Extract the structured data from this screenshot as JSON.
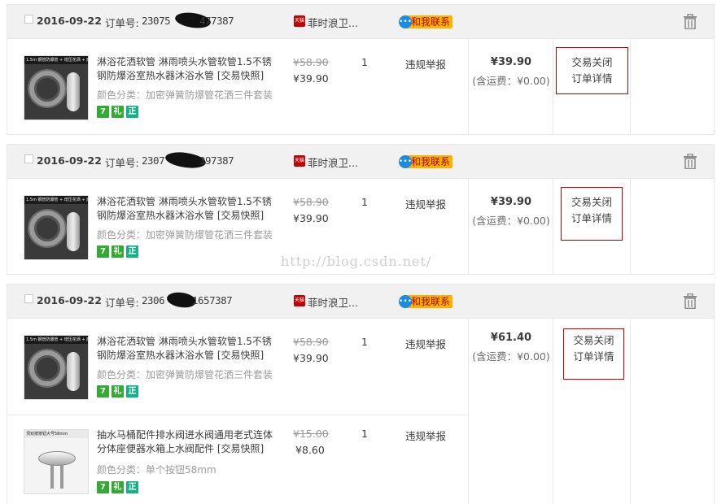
{
  "orders": [
    {
      "date": "2016-09-22",
      "order_label": "订单号:",
      "order_no_start": "23075",
      "order_no_end": "477387",
      "shop_badge": "天猫",
      "shop_name": "菲时浪卫...",
      "contact_label": "和我联系",
      "items": [
        {
          "title": "淋浴花洒软管 淋雨喷头水管软管1.5不锈钢防爆浴室热水器沐浴水管 [交易快照]",
          "sku": "颜色分类：加密弹簧防爆管花洒三件套装",
          "thumb_caption": "1.5m 钢管防爆管 + 增压花洒 + 底座",
          "orig_price": "¥58.90",
          "price": "¥39.90",
          "qty": "1",
          "action": "违规举报",
          "badges": [
            "7",
            "礼",
            "正"
          ]
        }
      ],
      "total": "¥39.90",
      "shipping": "(含运费：¥0.00)",
      "status": "交易关闭",
      "detail": "订单详情"
    },
    {
      "date": "2016-09-22",
      "order_label": "订单号:",
      "order_no_start": "2307",
      "order_no_end": "397387",
      "shop_badge": "天猫",
      "shop_name": "菲时浪卫...",
      "contact_label": "和我联系",
      "items": [
        {
          "title": "淋浴花洒软管 淋雨喷头水管软管1.5不锈钢防爆浴室热水器沐浴水管 [交易快照]",
          "sku": "颜色分类：加密弹簧防爆管花洒三件套装",
          "thumb_caption": "1.5m 钢管防爆管 + 增压花洒 + 底座",
          "orig_price": "¥58.90",
          "price": "¥39.90",
          "qty": "1",
          "action": "违规举报",
          "badges": [
            "7",
            "礼",
            "正"
          ]
        }
      ],
      "total": "¥39.90",
      "shipping": "(含运费：¥0.00)",
      "status": "交易关闭",
      "detail": "订单详情"
    },
    {
      "date": "2016-09-22",
      "order_label": "订单号:",
      "order_no_start": "2306",
      "order_no_end": "1657387",
      "shop_badge": "天猫",
      "shop_name": "菲时浪卫...",
      "contact_label": "和我联系",
      "items": [
        {
          "title": "淋浴花洒软管 淋雨喷头水管软管1.5不锈钢防爆浴室热水器沐浴水管 [交易快照]",
          "sku": "颜色分类：加密弹簧防爆管花洒三件套装",
          "thumb_caption": "1.5m 钢管防爆管 + 增压花洒 + 底座",
          "orig_price": "¥58.90",
          "price": "¥39.90",
          "qty": "1",
          "action": "违规举报",
          "badges": [
            "7",
            "礼",
            "正"
          ]
        },
        {
          "title": "抽水马桶配件排水阀进水阀通用老式连体分体座便器水箱上水阀配件 [交易快照]",
          "sku": "颜色分类：单个按钮58mm",
          "thumb_caption": "顶双按按钮大号58mm",
          "orig_price": "¥15.00",
          "price": "¥8.60",
          "qty": "1",
          "action": "违规举报",
          "badges": [
            "7",
            "礼",
            "正"
          ]
        }
      ],
      "total": "¥61.40",
      "shipping": "(含运费：¥0.00)",
      "status": "交易关闭",
      "detail": "订单详情"
    }
  ],
  "watermark": "http://blog.csdn.net/",
  "colors": {
    "header_bg": "#f1f1f1",
    "status_border": "#c40000",
    "contact_bg": "#fcb300",
    "badge_green": "#33aa33",
    "badge_teal": "#10b286",
    "tmall_red": "#c40000"
  },
  "icons": {
    "delete": "trash-icon",
    "contact": "chat-bubble-icon",
    "shop": "tmall-icon",
    "badges": [
      "seven-day-return-icon",
      "gift-icon",
      "genuine-icon"
    ]
  }
}
